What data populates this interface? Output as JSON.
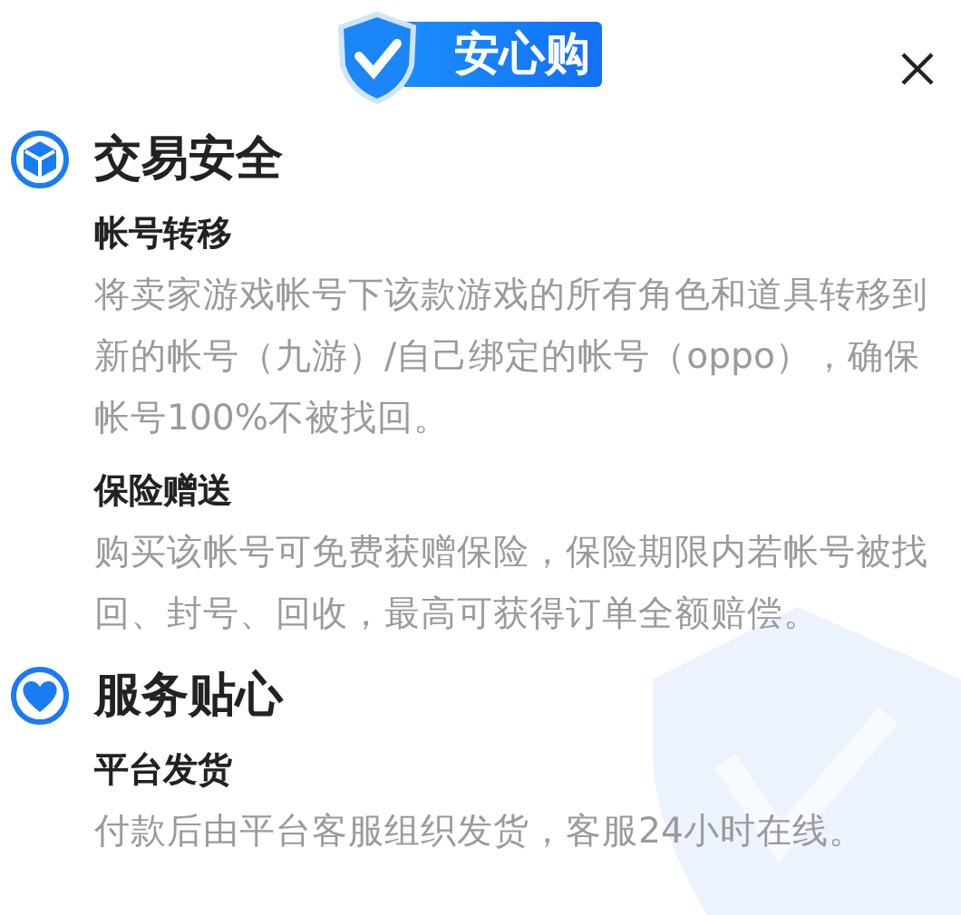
{
  "header": {
    "badge_text": "安心购"
  },
  "sections": [
    {
      "title": "交易安全",
      "items": [
        {
          "title": "帐号转移",
          "text": "将卖家游戏帐号下该款游戏的所有角色和道具转移到新的帐号（九游）/自己绑定的帐号（oppo），确保帐号100%不被找回。"
        },
        {
          "title": "保险赠送",
          "text": "购买该帐号可免费获赠保险，保险期限内若帐号被找回、封号、回收，最高可获得订单全额赔偿。"
        }
      ]
    },
    {
      "title": "服务贴心",
      "items": [
        {
          "title": "平台发货",
          "text": "付款后由平台客服组织发货，客服24小时在线。"
        }
      ]
    }
  ]
}
